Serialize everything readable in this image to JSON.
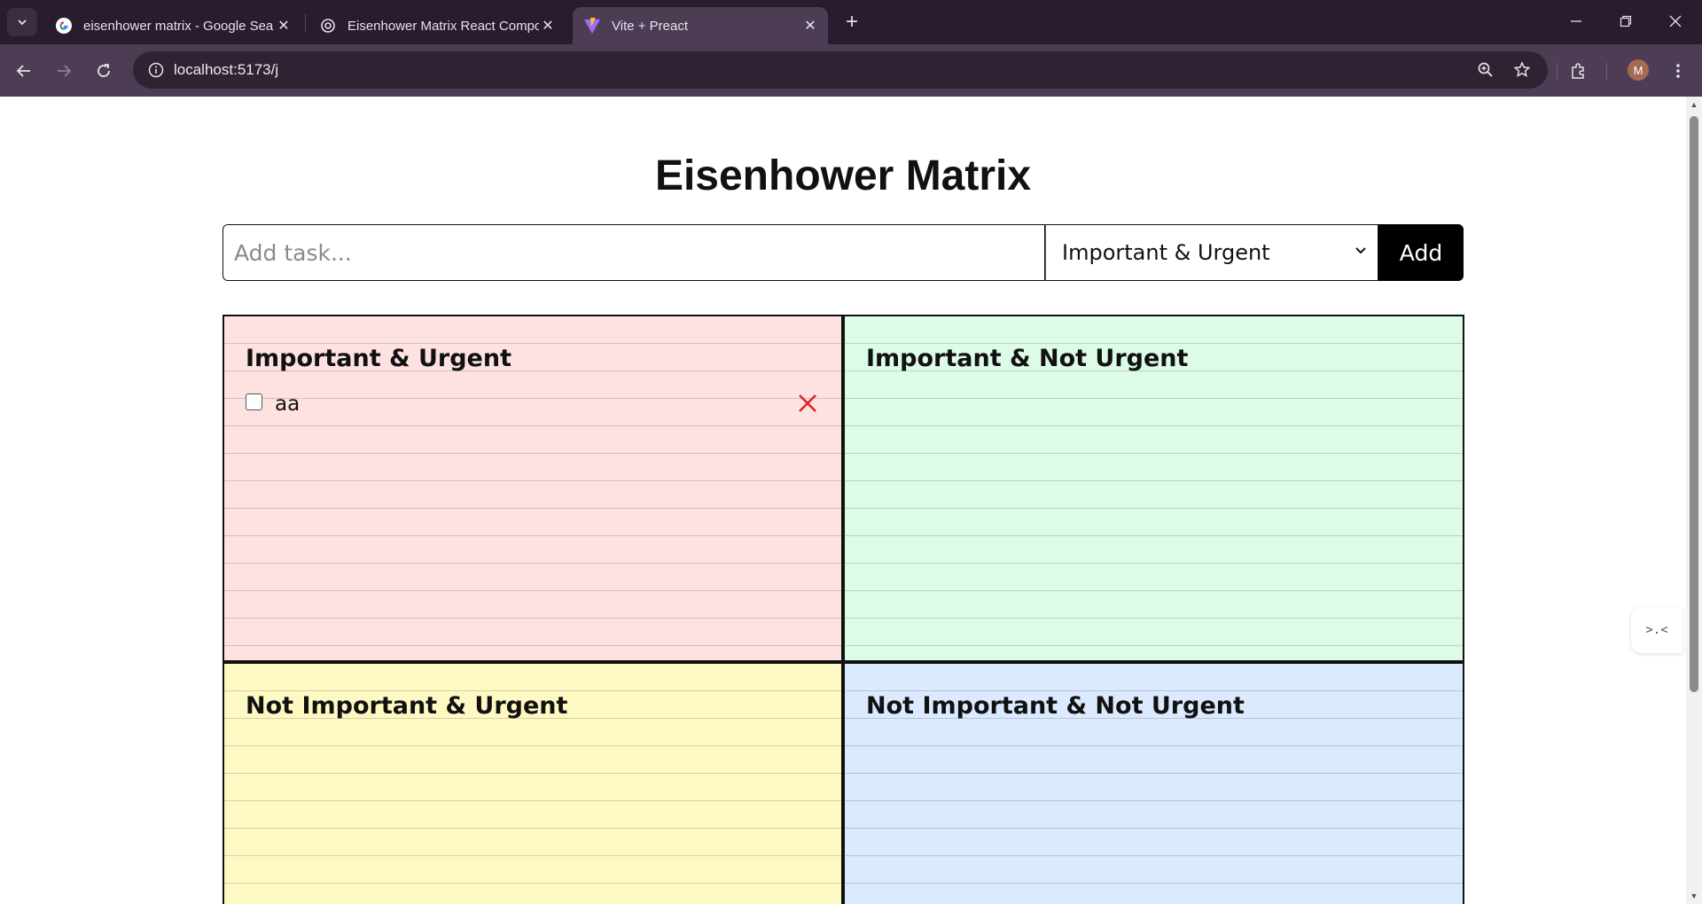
{
  "browser": {
    "tabs": [
      {
        "title": "eisenhower matrix - Google Sea",
        "favicon": "google-icon"
      },
      {
        "title": "Eisenhower Matrix React Compo",
        "favicon": "chatgpt-icon"
      },
      {
        "title": "Vite + Preact",
        "favicon": "vite-icon"
      }
    ],
    "url": "localhost:5173/j",
    "profile_initial": "M"
  },
  "page": {
    "title": "Eisenhower Matrix",
    "task_input_placeholder": "Add task...",
    "task_input_value": "",
    "selected_quadrant": "Important & Urgent",
    "add_label": "Add",
    "side_widget_glyph": ">.<"
  },
  "quadrants": [
    {
      "id": "ui",
      "title": "Important & Urgent",
      "color": "#fee2e2",
      "tasks": [
        {
          "text": "aa",
          "done": false
        }
      ]
    },
    {
      "id": "inu",
      "title": "Important & Not Urgent",
      "color": "#dcfce7",
      "tasks": []
    },
    {
      "id": "niu",
      "title": "Not Important & Urgent",
      "color": "#fef9c3",
      "tasks": []
    },
    {
      "id": "ninu",
      "title": "Not Important & Not Urgent",
      "color": "#dbeafe",
      "tasks": []
    }
  ],
  "colors": {
    "delete": "#dc2626",
    "chrome_dark": "#281c2e",
    "chrome_mid": "#4d3d54"
  }
}
